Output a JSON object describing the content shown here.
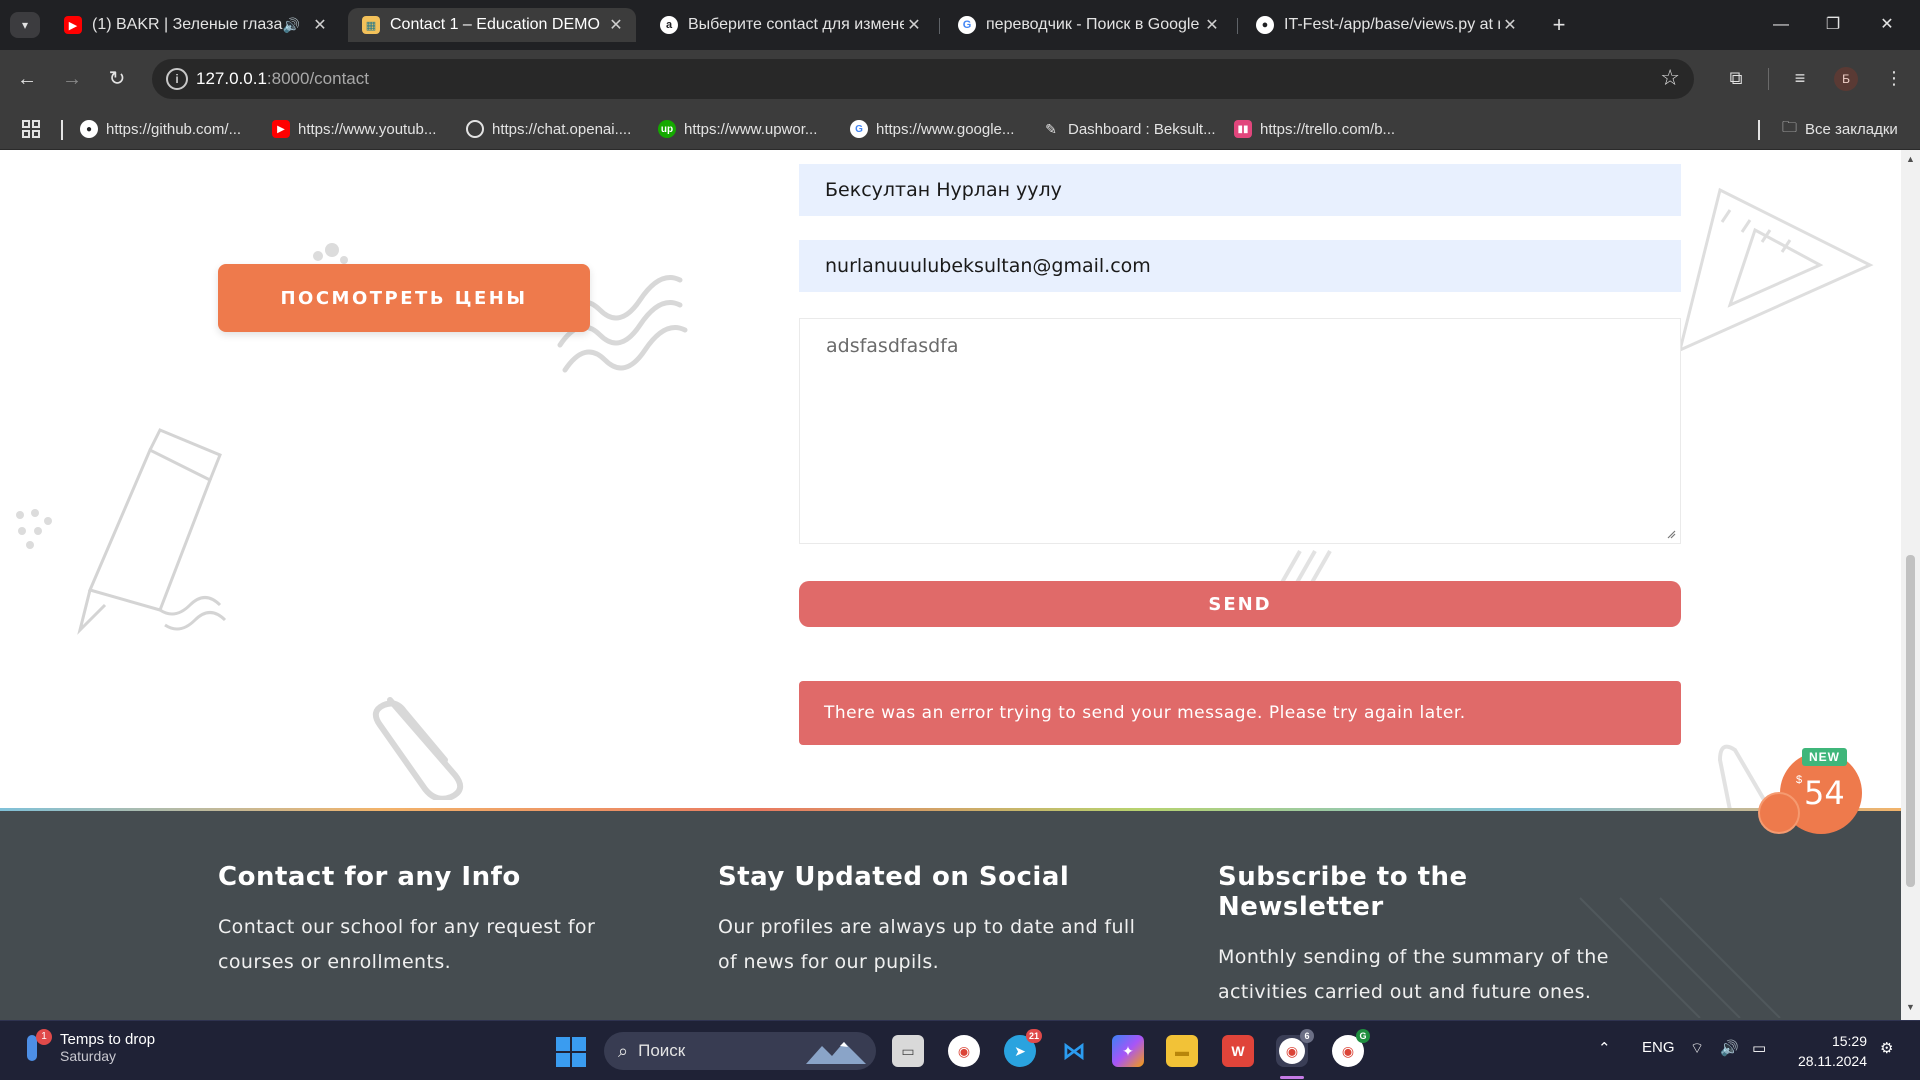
{
  "browser": {
    "tabs": [
      {
        "title": "(1) BAKR | Зеленые глаза | L",
        "favicon": "youtube-icon",
        "active": false
      },
      {
        "title": "Contact 1 – Education DEMO",
        "favicon": "site-icon",
        "active": true
      },
      {
        "title": "Выберите contact для изменен",
        "favicon": "django-icon",
        "active": false
      },
      {
        "title": "переводчик - Поиск в Google",
        "favicon": "google-icon",
        "active": false
      },
      {
        "title": "IT-Fest-/app/base/views.py at n",
        "favicon": "github-icon",
        "active": false
      }
    ],
    "url_host": "127.0.0.1",
    "url_rest": ":8000/contact",
    "profile_initial": "Б",
    "bookmarks": [
      {
        "label": "https://github.com/...",
        "icon": "github-icon"
      },
      {
        "label": "https://www.youtub...",
        "icon": "youtube-icon"
      },
      {
        "label": "https://chat.openai....",
        "icon": "openai-icon"
      },
      {
        "label": "https://www.upwor...",
        "icon": "upwork-icon"
      },
      {
        "label": "https://www.google...",
        "icon": "google-icon"
      },
      {
        "label": "Dashboard : Beksult...",
        "icon": "dashboard-icon"
      },
      {
        "label": "https://trello.com/b...",
        "icon": "trello-icon"
      }
    ],
    "all_bookmarks": "Все закладки"
  },
  "page": {
    "cta_button": "ПОСМОТРЕТЬ ЦЕНЫ",
    "form": {
      "name_value": "Бексултан Нурлан уулу",
      "email_value": "nurlanuuulubeksultan@gmail.com",
      "message_value": "adsfasdfasdfa",
      "send_label": "SEND"
    },
    "error_message": "There was an error trying to send your message. Please try again later.",
    "footer": {
      "columns": [
        {
          "title": "Contact for any Info",
          "text": "Contact our school for any request for courses or enrollments."
        },
        {
          "title": "Stay Updated on Social",
          "text": "Our profiles are always up to date and full of news for our pupils."
        },
        {
          "title": "Subscribe to the Newsletter",
          "text": "Monthly sending of the summary of the activities carried out and future ones."
        }
      ]
    },
    "badge": {
      "new": "NEW",
      "currency": "$",
      "price": "54"
    }
  },
  "taskbar": {
    "weather_line1": "Temps to drop",
    "weather_line2": "Saturday",
    "weather_alert": "1",
    "search_placeholder": "Поиск",
    "telegram_badge": "21",
    "chrome_badge1": "6",
    "chrome_badge2": "G",
    "language": "ENG",
    "time": "15:29",
    "date": "28.11.2024"
  },
  "colors": {
    "accent_orange": "#ee7a4c",
    "send_red": "#e06a69",
    "footer_bg": "#454c50",
    "input_bg": "#e8f0fe"
  }
}
